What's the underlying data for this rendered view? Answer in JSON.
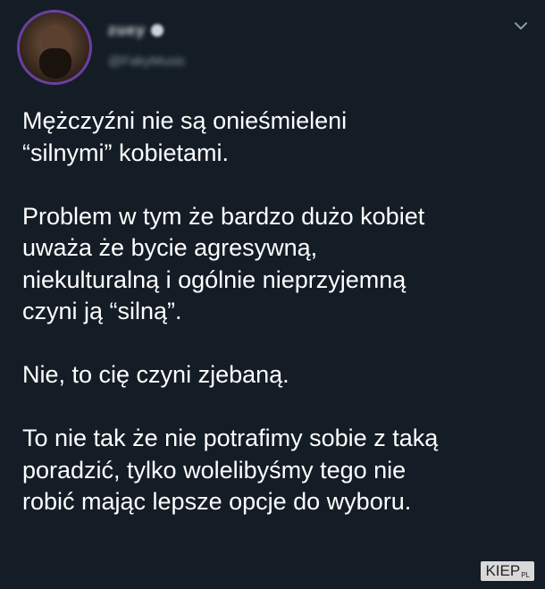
{
  "header": {
    "display_name": "zuey",
    "handle": "@FakyMusic",
    "menu_icon": "chevron-down-icon",
    "avatar_icon": "avatar"
  },
  "tweet": {
    "paragraphs": [
      "Mężczyźni nie są onieśmieleni\n“silnymi” kobietami.",
      "Problem w tym że bardzo dużo kobiet\nuważa że bycie agresywną,\nniekulturalną i ogólnie nieprzyjemną\nczyni ją “silną”.",
      "Nie, to cię czyni zjebaną.",
      "To nie tak że nie potrafimy sobie z taką\nporadzić, tylko wolelibyśmy tego nie\nrobić mając lepsze opcje do wyboru."
    ]
  },
  "watermark": {
    "main": "KIEP",
    "suffix": "PL"
  },
  "colors": {
    "background": "#141d26",
    "text": "#ffffff",
    "secondary": "#8899a6",
    "avatar_ring": "#6b3fa0"
  }
}
